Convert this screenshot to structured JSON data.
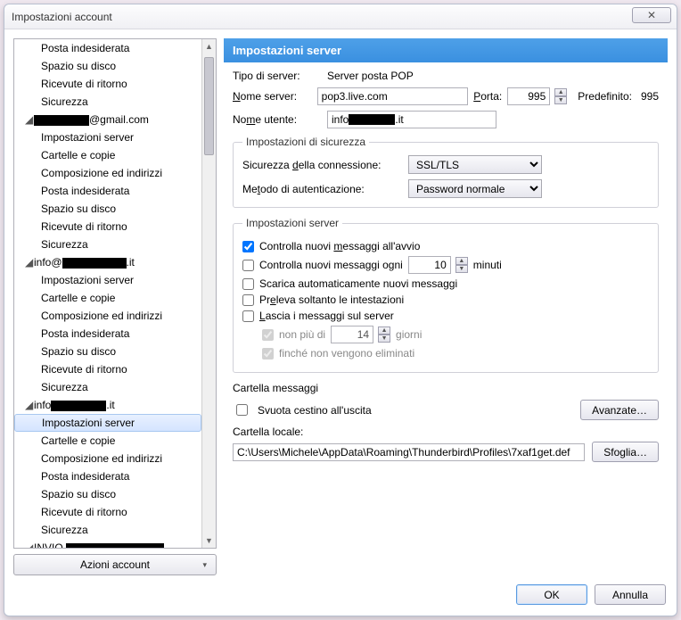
{
  "window": {
    "title": "Impostazioni account",
    "close": "✕"
  },
  "sidebar": {
    "actions_label": "Azioni account",
    "items": [
      {
        "type": "sub",
        "label": "Posta indesiderata"
      },
      {
        "type": "sub",
        "label": "Spazio su disco"
      },
      {
        "type": "sub",
        "label": "Ricevute di ritorno"
      },
      {
        "type": "sub",
        "label": "Sicurezza"
      },
      {
        "type": "account",
        "label_prefix": "",
        "label_suffix": "@gmail.com",
        "redact_w": 62
      },
      {
        "type": "sub",
        "label": "Impostazioni server"
      },
      {
        "type": "sub",
        "label": "Cartelle e copie"
      },
      {
        "type": "sub",
        "label": "Composizione ed indirizzi"
      },
      {
        "type": "sub",
        "label": "Posta indesiderata"
      },
      {
        "type": "sub",
        "label": "Spazio su disco"
      },
      {
        "type": "sub",
        "label": "Ricevute di ritorno"
      },
      {
        "type": "sub",
        "label": "Sicurezza"
      },
      {
        "type": "account",
        "label_prefix": "info@",
        "label_suffix": ".it",
        "redact_w": 72
      },
      {
        "type": "sub",
        "label": "Impostazioni server"
      },
      {
        "type": "sub",
        "label": "Cartelle e copie"
      },
      {
        "type": "sub",
        "label": "Composizione ed indirizzi"
      },
      {
        "type": "sub",
        "label": "Posta indesiderata"
      },
      {
        "type": "sub",
        "label": "Spazio su disco"
      },
      {
        "type": "sub",
        "label": "Ricevute di ritorno"
      },
      {
        "type": "sub",
        "label": "Sicurezza"
      },
      {
        "type": "account",
        "label_prefix": "info",
        "label_suffix": ".it",
        "redact_w": 62
      },
      {
        "type": "sub",
        "label": "Impostazioni server",
        "selected": true
      },
      {
        "type": "sub",
        "label": "Cartelle e copie"
      },
      {
        "type": "sub",
        "label": "Composizione ed indirizzi"
      },
      {
        "type": "sub",
        "label": "Posta indesiderata"
      },
      {
        "type": "sub",
        "label": "Spazio su disco"
      },
      {
        "type": "sub",
        "label": "Ricevute di ritorno"
      },
      {
        "type": "sub",
        "label": "Sicurezza"
      },
      {
        "type": "account",
        "label_prefix": "INVIO ",
        "label_suffix": "",
        "redact_w": 110
      }
    ]
  },
  "panel": {
    "header": "Impostazioni server",
    "server_type_label": "Tipo di server:",
    "server_type_value": "Server posta POP",
    "server_name_label": "Nome server:",
    "server_name_value": "pop3.live.com",
    "port_label": "Porta:",
    "port_value": "995",
    "default_label": "Predefinito:",
    "default_value": "995",
    "user_label": "Nome utente:",
    "user_prefix": "info",
    "user_suffix": ".it",
    "security": {
      "legend": "Impostazioni di sicurezza",
      "conn_label": "Sicurezza della connessione:",
      "conn_value": "SSL/TLS",
      "auth_label": "Metodo di autenticazione:",
      "auth_value": "Password normale"
    },
    "server_settings": {
      "legend": "Impostazioni server",
      "check_startup": "Controlla nuovi messaggi all'avvio",
      "check_every_pre": "Controlla nuovi messaggi ogni",
      "check_every_val": "10",
      "check_every_post": "minuti",
      "auto_download": "Scarica automaticamente nuovi messaggi",
      "headers_only": "Preleva soltanto le intestazioni",
      "leave_on_server": "Lascia i messaggi sul server",
      "at_most_pre": "non più di",
      "at_most_val": "14",
      "at_most_post": "giorni",
      "until_deleted": "finché non vengono eliminati"
    },
    "messages": {
      "legend": "Cartella messaggi",
      "empty_trash": "Svuota cestino all'uscita",
      "advanced": "Avanzate…",
      "local_folder_label": "Cartella locale:",
      "local_folder_value": "C:\\Users\\Michele\\AppData\\Roaming\\Thunderbird\\Profiles\\7xaf1get.def",
      "browse": "Sfoglia…"
    }
  },
  "footer": {
    "ok": "OK",
    "cancel": "Annulla"
  }
}
